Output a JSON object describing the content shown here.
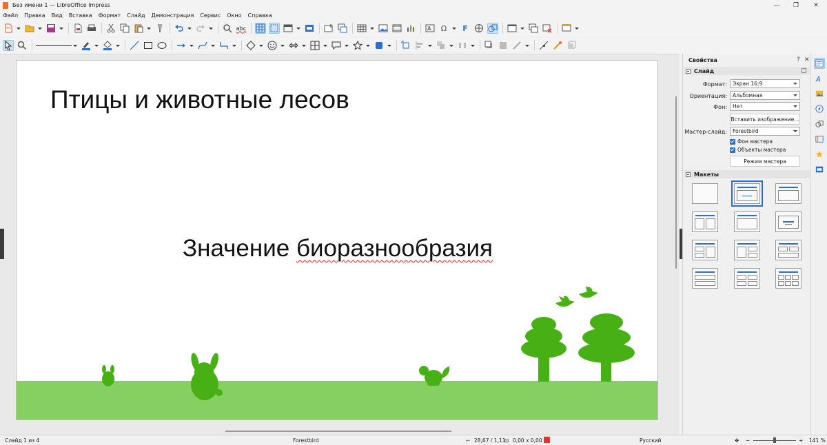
{
  "window": {
    "title": "Без имени 1 — LibreOffice Impress",
    "min": "—",
    "max": "❐",
    "close": "✕"
  },
  "menu": [
    "Файл",
    "Правка",
    "Вид",
    "Вставка",
    "Формат",
    "Слайд",
    "Демонстрация",
    "Сервис",
    "Окно",
    "Справка"
  ],
  "icons": {
    "spellcheck": "abc",
    "fontwork": "F",
    "special_char": "Ω"
  },
  "slide": {
    "title": "Птицы и животные лесов",
    "subtitle_word1": "Значение",
    "subtitle_word2": "биоразнообразия",
    "colors": {
      "ground": "#86cf63",
      "silhouette": "#47b015"
    }
  },
  "sidebar": {
    "title": "Свойства",
    "help": "?",
    "close": "✕",
    "slide_section": "Слайд",
    "format_label": "Формат:",
    "format_value": "Экран 16:9",
    "orientation_label": "Ориентация:",
    "orientation_value": "Альбомная",
    "background_label": "Фон:",
    "background_value": "Нет",
    "insert_image": "Вставить изображение...",
    "master_label": "Мастер-слайд:",
    "master_value": "Forestbird",
    "master_bg": "Фон мастера",
    "master_objects": "Объекты мастера",
    "master_mode": "Режим мастера",
    "layouts_section": "Макеты"
  },
  "status": {
    "slide": "Слайд 1 из 4",
    "master": "Forestbird",
    "position": "28,67 / 1,11",
    "size": "0,00 x 0,00",
    "language": "Русский",
    "zoom_minus": "−",
    "zoom_plus": "+",
    "zoom": "141 %"
  },
  "colors": {
    "accent": "#2a6fd1",
    "app_icon": "#e8712d"
  }
}
